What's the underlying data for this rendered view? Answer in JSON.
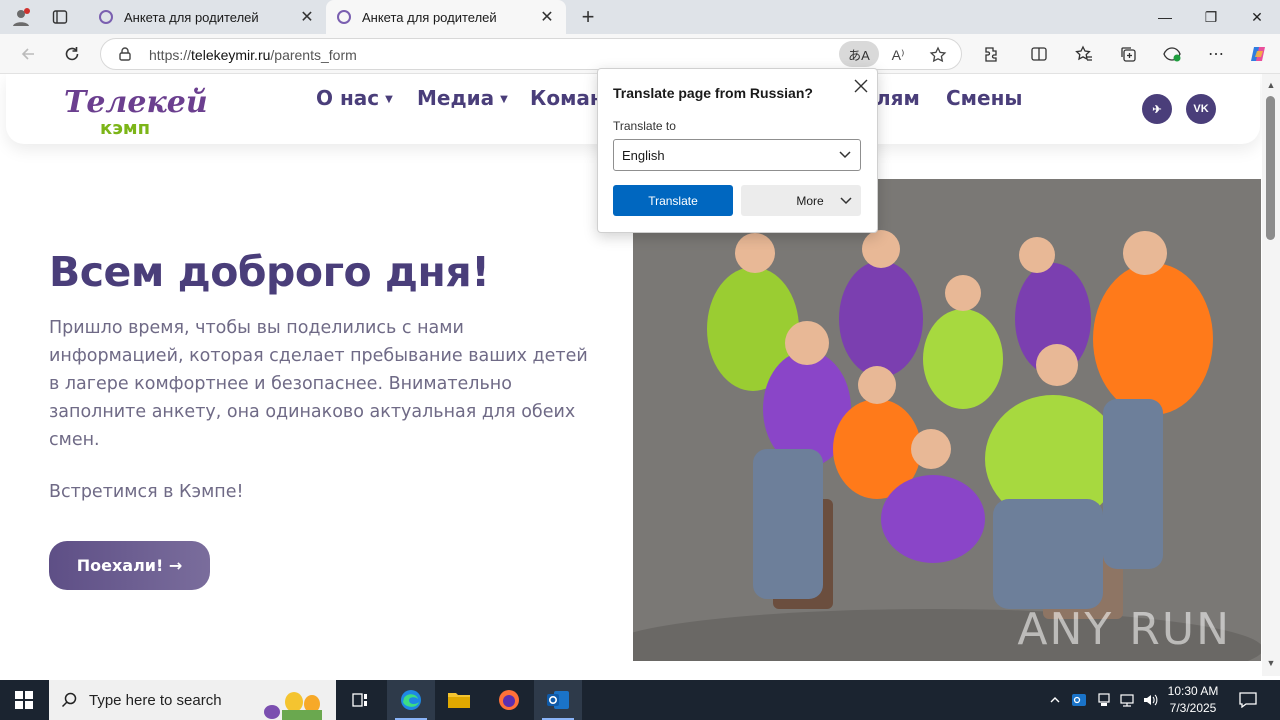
{
  "browser": {
    "tabs": [
      {
        "title": "Анкета для родителей",
        "active": false
      },
      {
        "title": "Анкета для родителей",
        "active": true
      }
    ],
    "url_prefix": "https://",
    "url_domain": "telekeymir.ru",
    "url_path": "/parents_form",
    "translate_indicator": "あA",
    "window_controls": {
      "minimize": "—",
      "restore": "❐",
      "close": "✕"
    }
  },
  "site": {
    "logo_top": "Телекей",
    "logo_bottom": "кэмп",
    "nav": [
      {
        "label": "О нас",
        "has_caret": true
      },
      {
        "label": "Медиа",
        "has_caret": true
      },
      {
        "label": "Коман",
        "has_caret": false
      },
      {
        "label": "лям",
        "has_caret": false
      },
      {
        "label": "Смены",
        "has_caret": false
      }
    ],
    "social": {
      "telegram": "✈",
      "vk": "VK"
    },
    "hero": {
      "title": "Всем доброго дня!",
      "text": "Пришло время, чтобы вы поделились с нами информацией, которая сделает пребывание ваших детей в лагере комфортнее и безопаснее. Внимательно заполните анкету, она одинаково актуальная для обеих смен.",
      "greeting": "Встретимся в Кэмпе!",
      "cta": "Поехали! →"
    },
    "photo": {
      "watermark": "ANY RUN",
      "alt": "Group photo of teens in green, purple and orange hoodies"
    }
  },
  "translate_popup": {
    "title": "Translate page from Russian?",
    "label": "Translate to",
    "selected_language": "English",
    "translate_button": "Translate",
    "more_button": "More"
  },
  "taskbar": {
    "search_placeholder": "Type here to search",
    "time": "10:30 AM",
    "date": "7/3/2025"
  },
  "colors": {
    "brand_purple": "#4a3e7a",
    "text_gray": "#6f6a86",
    "translate_blue": "#0067c0",
    "taskbar": "#1b2430"
  }
}
